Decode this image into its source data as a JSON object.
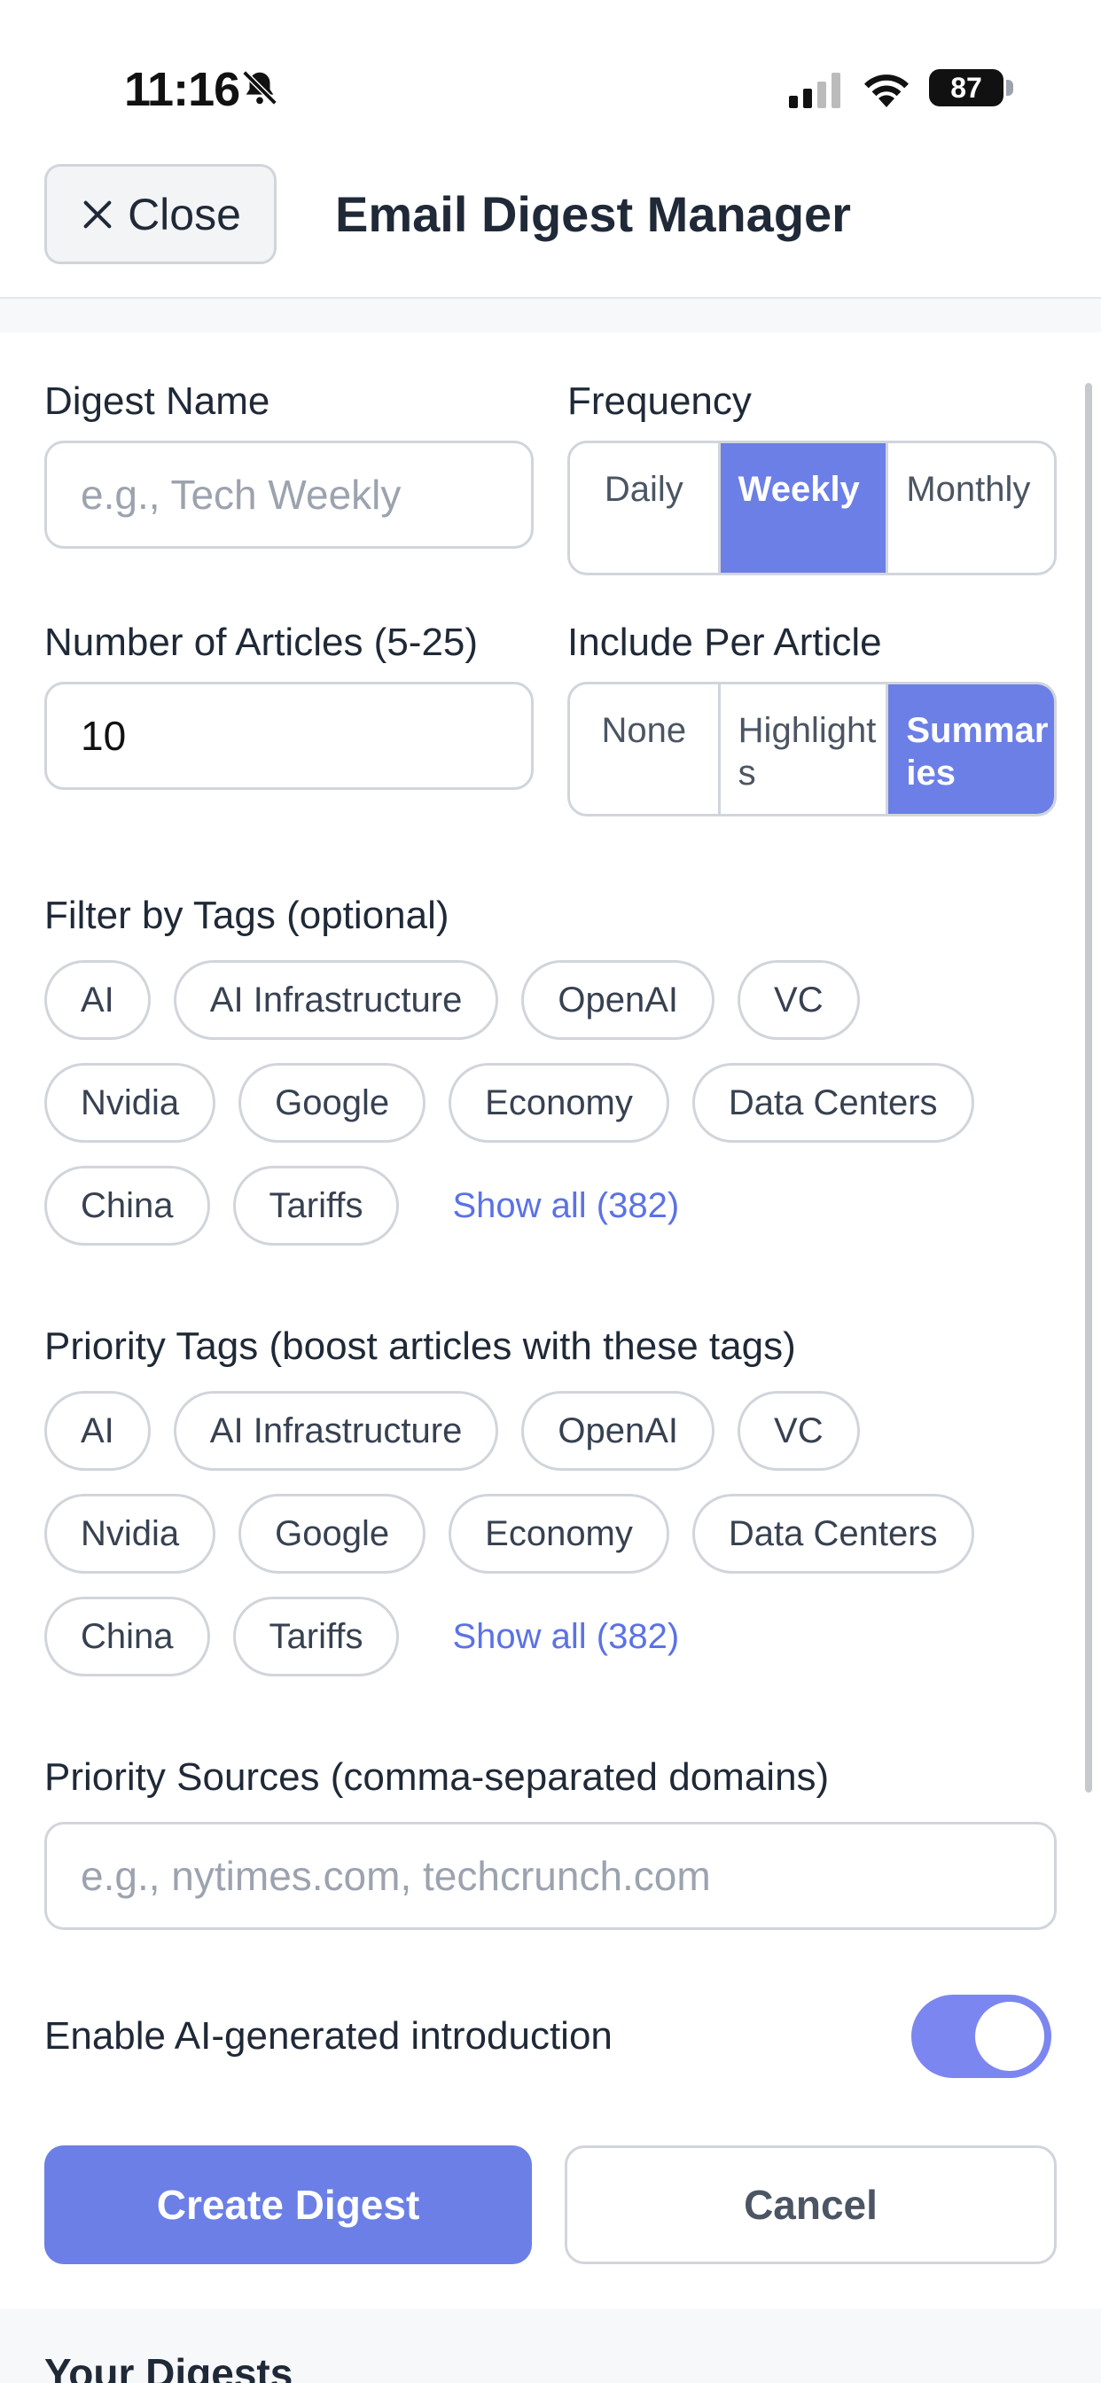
{
  "status_bar": {
    "time": "11:16",
    "battery": "87",
    "icons": [
      "bell-slash-icon",
      "signal-icon",
      "wifi-icon",
      "battery-icon"
    ]
  },
  "header": {
    "close_label": "Close",
    "title": "Email Digest Manager"
  },
  "form": {
    "digest_name": {
      "label": "Digest Name",
      "placeholder": "e.g., Tech Weekly",
      "value": ""
    },
    "frequency": {
      "label": "Frequency",
      "options": [
        "Daily",
        "Weekly",
        "Monthly"
      ],
      "selected": "Weekly"
    },
    "num_articles": {
      "label": "Number of Articles (5-25)",
      "value": "10"
    },
    "include_per_article": {
      "label": "Include Per Article",
      "options": [
        "None",
        "Highlights",
        "Summaries"
      ],
      "selected": "Summaries"
    },
    "filter_tags": {
      "label": "Filter by Tags (optional)",
      "tags": [
        "AI",
        "AI Infrastructure",
        "OpenAI",
        "VC",
        "Nvidia",
        "Google",
        "Economy",
        "Data Centers",
        "China",
        "Tariffs"
      ],
      "show_all": "Show all (382)"
    },
    "priority_tags": {
      "label": "Priority Tags (boost articles with these tags)",
      "tags": [
        "AI",
        "AI Infrastructure",
        "OpenAI",
        "VC",
        "Nvidia",
        "Google",
        "Economy",
        "Data Centers",
        "China",
        "Tariffs"
      ],
      "show_all": "Show all (382)"
    },
    "priority_sources": {
      "label": "Priority Sources (comma-separated domains)",
      "placeholder": "e.g., nytimes.com, techcrunch.com",
      "value": ""
    },
    "ai_intro": {
      "label": "Enable AI-generated introduction",
      "enabled": true
    },
    "create_label": "Create Digest",
    "cancel_label": "Cancel"
  },
  "your_digests": {
    "title": "Your Digests"
  },
  "colors": {
    "accent": "#6b7fe6",
    "link": "#5b72e6",
    "toggle": "#7c86f0"
  }
}
